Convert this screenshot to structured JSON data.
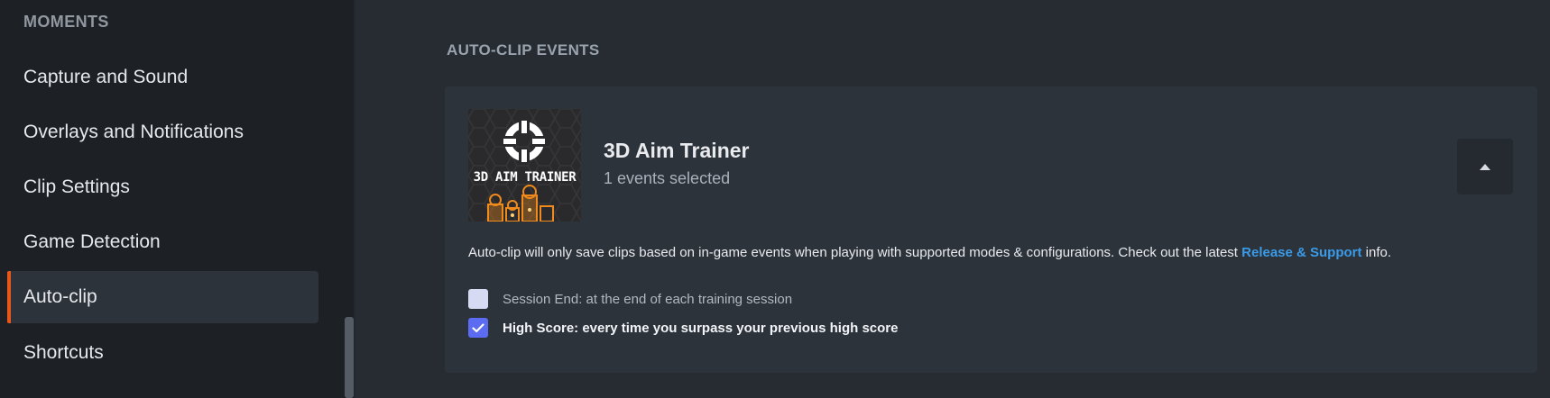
{
  "sidebar": {
    "section_label": "MOMENTS",
    "items": [
      {
        "label": "Capture and Sound"
      },
      {
        "label": "Overlays and Notifications"
      },
      {
        "label": "Clip Settings"
      },
      {
        "label": "Game Detection"
      },
      {
        "label": "Auto-clip",
        "active": true
      },
      {
        "label": "Shortcuts"
      }
    ]
  },
  "main": {
    "section_title": "AUTO-CLIP EVENTS",
    "game": {
      "thumbnail_text": "3D AIM TRAINER",
      "title": "3D Aim Trainer",
      "subtitle": "1 events selected",
      "collapse_icon": "caret-up-icon"
    },
    "info": {
      "text": "Auto-clip will only save clips based on in-game events when playing with supported modes & configurations. Check out the latest ",
      "link": "Release & Support",
      "suffix": " info."
    },
    "events": [
      {
        "label": "Session End: at the end of each training session",
        "checked": false
      },
      {
        "label": "High Score: every time you surpass your previous high score",
        "checked": true
      }
    ]
  },
  "colors": {
    "accent": "#e8571a",
    "link": "#3a9be8",
    "checkbox_checked": "#5b6bf2",
    "checkbox_unchecked": "#d6dbf3"
  }
}
